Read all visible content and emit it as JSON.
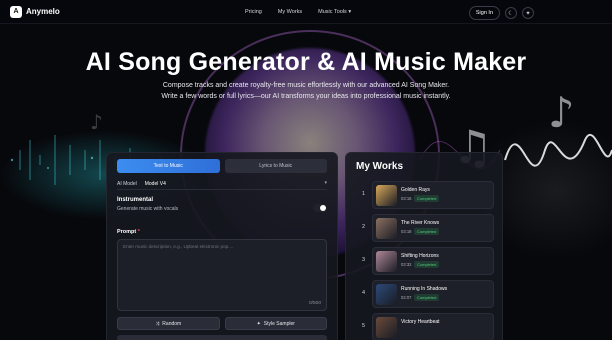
{
  "nav": {
    "brand": "Anymelo",
    "logo_glyph": "A",
    "links": [
      "Pricing",
      "My Works",
      "Music Tools ▾"
    ],
    "signin": "Sign In",
    "theme_icon": "☾",
    "extra_icon": "✦"
  },
  "hero": {
    "title": "AI Song Generator & AI Music Maker",
    "subtitle_line1": "Compose tracks and create royalty-free music effortlessly with our advanced AI Song Maker.",
    "subtitle_line2": "Write a few words or full lyrics—our AI transforms your ideas into professional music instantly."
  },
  "form": {
    "tab_text": "Text to Music",
    "tab_lyrics": "Lyrics to Music",
    "model_label": "AI Model",
    "model_value": "Model V4",
    "instrumental_title": "Instrumental",
    "instrumental_sub": "Generate music with vocals",
    "instrumental_on": true,
    "prompt_label": "Prompt",
    "prompt_required": "*",
    "prompt_placeholder": "Enter music description, e.g., Upbeat electronic pop....",
    "counter": "0/500",
    "random_label": "Random",
    "style_label": "Style Sampler"
  },
  "works": {
    "title": "My Works",
    "items": [
      {
        "num": "1",
        "title": "Golden Rays",
        "time": "03:16",
        "status": "Completed",
        "color": "#d9a85a"
      },
      {
        "num": "2",
        "title": "The River Knows",
        "time": "03:18",
        "status": "Completed",
        "color": "#8c7060"
      },
      {
        "num": "3",
        "title": "Shifting Horizons",
        "time": "03:32",
        "status": "Completed",
        "color": "#b08898"
      },
      {
        "num": "4",
        "title": "Running In Shadows",
        "time": "02:07",
        "status": "Completed",
        "color": "#2c4a7a"
      },
      {
        "num": "5",
        "title": "Victory Heartbeat",
        "time": "",
        "status": "",
        "color": "#6a4a3a"
      }
    ]
  },
  "colors": {
    "accent": "#3c8df0",
    "status_green": "#4bd17b"
  }
}
